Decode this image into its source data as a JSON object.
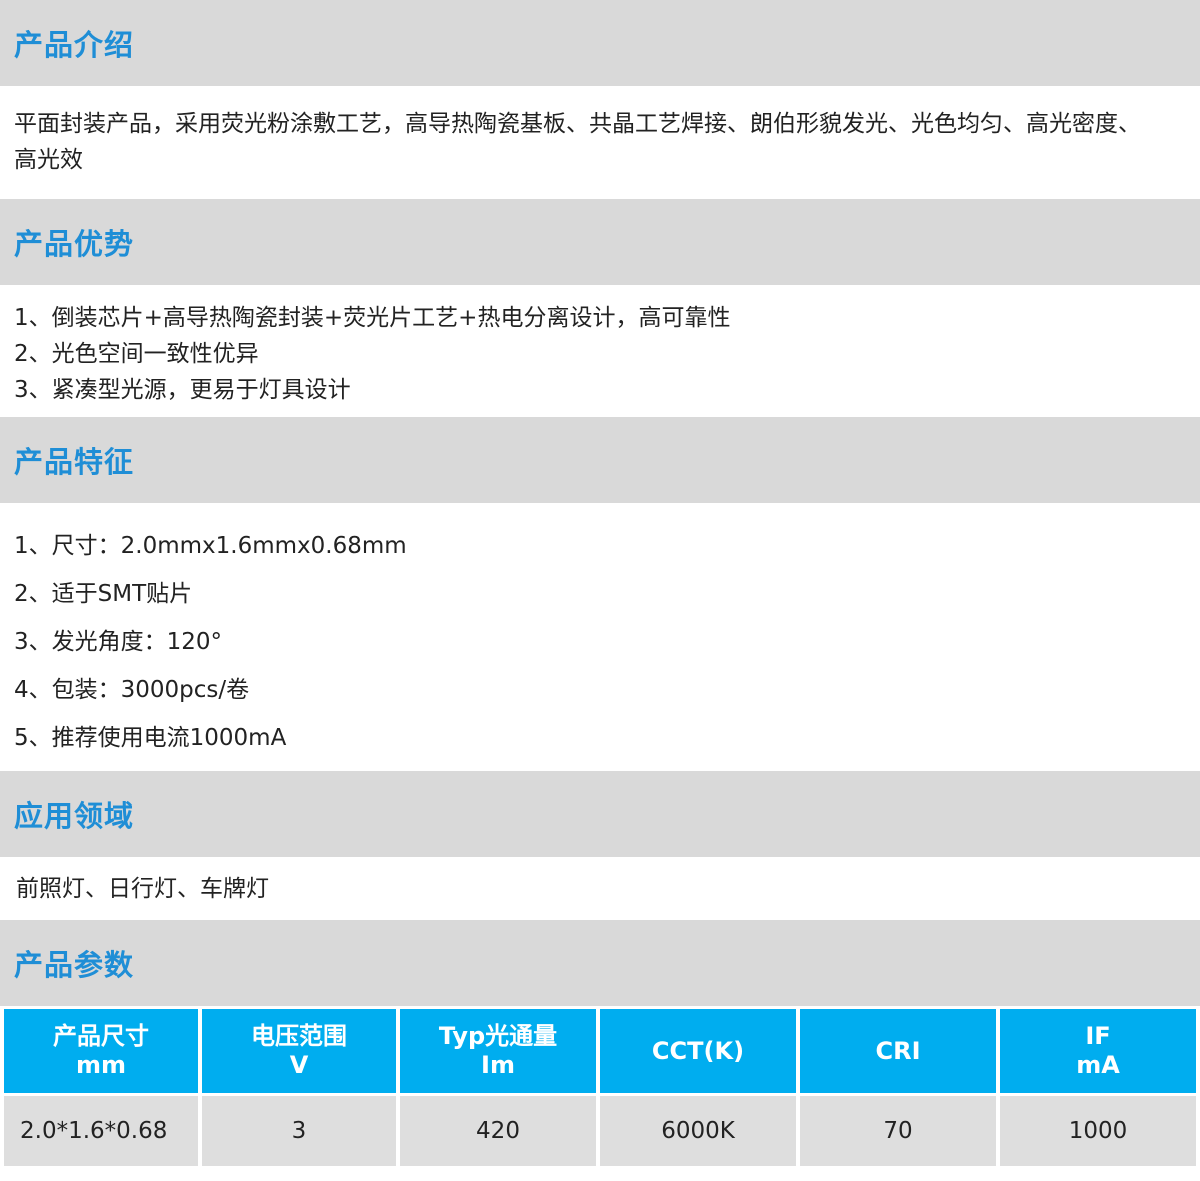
{
  "intro": {
    "title": "产品介绍",
    "lines": [
      "平面封装产品，采用荧光粉涂敷工艺，高导热陶瓷基板、共晶工艺焊接、朗伯形貌发光、光色均匀、高光密度、",
      "高光效"
    ]
  },
  "advantages": {
    "title": "产品优势",
    "items": [
      "1、倒装芯片+高导热陶瓷封装+荧光片工艺+热电分离设计，高可靠性",
      "2、光色空间一致性优异",
      "3、紧凑型光源，更易于灯具设计"
    ]
  },
  "features": {
    "title": "产品特征",
    "items": [
      "1、尺寸：2.0mmx1.6mmx0.68mm",
      "2、适于SMT贴片",
      "3、发光角度：120°",
      "4、包装：3000pcs/卷",
      "5、推荐使用电流1000mA"
    ]
  },
  "applications": {
    "title": "应用领域",
    "text": "前照灯、日行灯、车牌灯"
  },
  "params": {
    "title": "产品参数",
    "headers": [
      {
        "line1": "产品尺寸",
        "line2": "mm"
      },
      {
        "line1": "电压范围",
        "line2": "V"
      },
      {
        "line1": "Typ光通量",
        "line2": "Im"
      },
      {
        "line1": "CCT(K)",
        "line2": ""
      },
      {
        "line1": "CRI",
        "line2": ""
      },
      {
        "line1": "IF",
        "line2": "mA"
      }
    ],
    "rows": [
      [
        "2.0*1.6*0.68",
        "3",
        "420",
        "6000K",
        "70",
        "1000"
      ]
    ]
  },
  "colors": {
    "header_bg": "#d9d9d9",
    "title_blue": "#1f8ed6",
    "table_header_bg": "#00adef",
    "table_cell_bg": "#dedede"
  }
}
